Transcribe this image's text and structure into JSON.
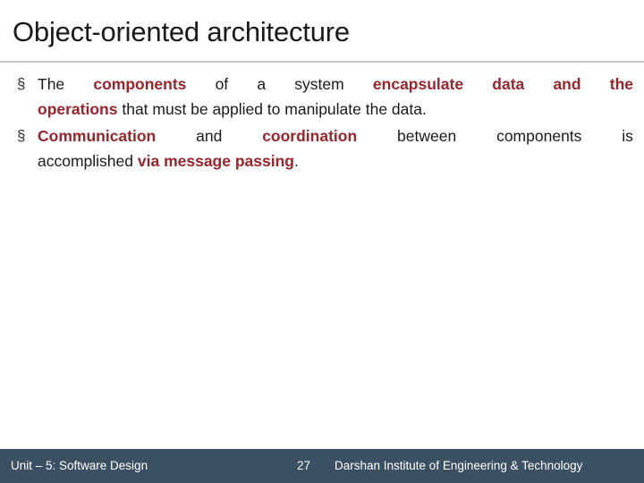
{
  "slide": {
    "title": "Object-oriented architecture",
    "bullets": [
      {
        "marker": "§",
        "line1": {
          "w1": "The",
          "w2": "components",
          "w3": "of",
          "w4": "a",
          "w5": "system",
          "w6": "encapsulate",
          "w7": "data",
          "w8": "and",
          "w9": "the"
        },
        "line2": {
          "w1": "operations",
          "w2": "that must be applied to manipulate the data."
        }
      },
      {
        "marker": "§",
        "line1": {
          "w1": "Communication",
          "w2": "and",
          "w3": "coordination",
          "w4": "between",
          "w5": "components",
          "w6": "is"
        },
        "line2": {
          "w1": "accomplished",
          "w2": "via message passing",
          "w3": "."
        }
      }
    ]
  },
  "footer": {
    "left": "Unit – 5: Software Design",
    "page": "27",
    "right": "Darshan Institute of Engineering & Technology"
  }
}
